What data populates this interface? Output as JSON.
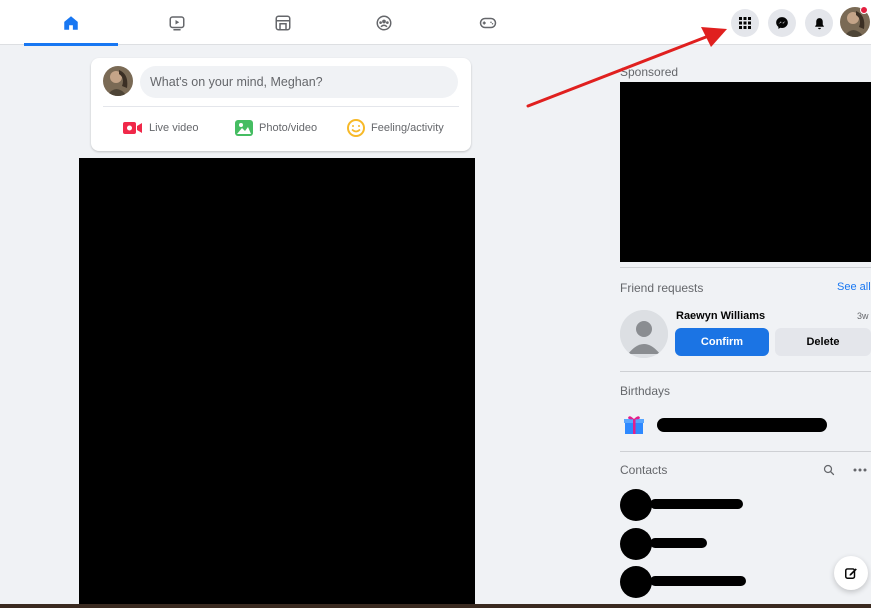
{
  "nav": {
    "tabs": [
      {
        "icon": "home-icon",
        "active": true
      },
      {
        "icon": "watch-video-icon",
        "active": false
      },
      {
        "icon": "marketplace-icon",
        "active": false
      },
      {
        "icon": "groups-icon",
        "active": false
      },
      {
        "icon": "gaming-icon",
        "active": false
      }
    ],
    "right_buttons": [
      "menu-grid-icon",
      "messenger-icon",
      "notifications-bell-icon",
      "profile-avatar"
    ],
    "accent_color": "#1877f2"
  },
  "composer": {
    "placeholder": "What's on your mind, Meghan?",
    "actions": [
      {
        "label": "Live video",
        "icon": "live-video-icon",
        "color": "#f02849"
      },
      {
        "label": "Photo/video",
        "icon": "photo-video-icon",
        "color": "#45bd62"
      },
      {
        "label": "Feeling/activity",
        "icon": "feeling-icon",
        "color": "#f7b928"
      }
    ]
  },
  "sidebar": {
    "sponsored_title": "Sponsored",
    "friend_requests": {
      "title": "Friend requests",
      "see_all": "See all",
      "request": {
        "name": "Raewyn Williams",
        "time": "3w",
        "confirm_label": "Confirm",
        "delete_label": "Delete"
      }
    },
    "birthdays_title": "Birthdays",
    "contacts_title": "Contacts",
    "contacts_search_icon": "search-icon",
    "contacts_more_icon": "more-options-icon"
  }
}
